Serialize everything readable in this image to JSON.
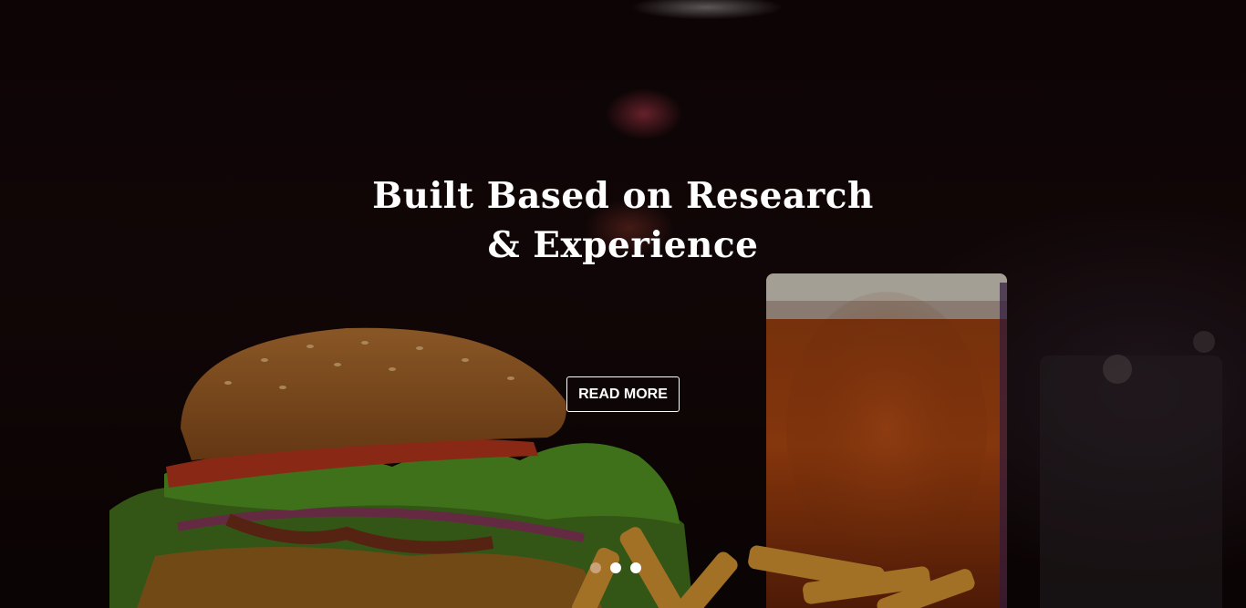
{
  "hero": {
    "headline_line1": "Built Based on Research",
    "headline_line2": "& Experience",
    "button_label": "READ MORE"
  },
  "carousel": {
    "slides": [
      {
        "active": true
      },
      {
        "active": false
      },
      {
        "active": false
      }
    ],
    "active_color": "#c9a27a",
    "inactive_color": "#ffffff"
  }
}
